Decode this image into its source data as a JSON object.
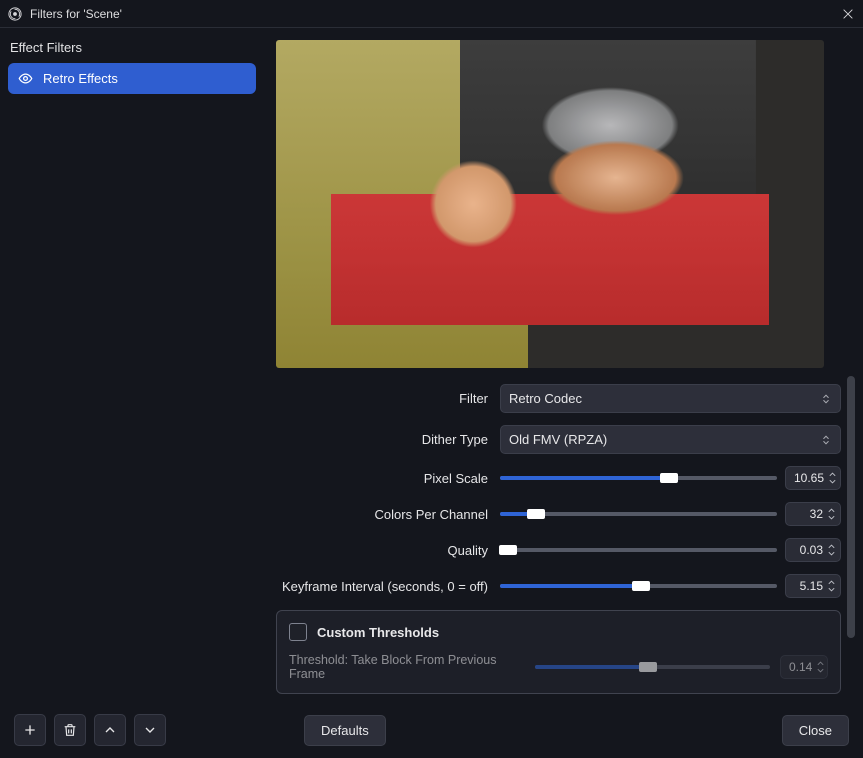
{
  "window": {
    "title": "Filters for 'Scene'"
  },
  "sidebar": {
    "section_label": "Effect Filters",
    "items": [
      {
        "label": "Retro Effects"
      }
    ]
  },
  "settings": {
    "filter": {
      "label": "Filter",
      "value": "Retro Codec"
    },
    "dither": {
      "label": "Dither Type",
      "value": "Old FMV (RPZA)"
    },
    "pixel_scale": {
      "label": "Pixel Scale",
      "value": "10.65",
      "fill_percent": 61
    },
    "colors_per_channel": {
      "label": "Colors Per Channel",
      "value": "32",
      "fill_percent": 13
    },
    "quality": {
      "label": "Quality",
      "value": "0.03",
      "fill_percent": 3
    },
    "keyframe_interval": {
      "label": "Keyframe Interval (seconds, 0 = off)",
      "value": "5.15",
      "fill_percent": 51
    },
    "custom_thresholds": {
      "label": "Custom Thresholds",
      "threshold_prev": {
        "label": "Threshold: Take Block From Previous Frame",
        "value": "0.14",
        "fill_percent": 48
      }
    }
  },
  "footer": {
    "defaults": "Defaults",
    "close": "Close"
  }
}
